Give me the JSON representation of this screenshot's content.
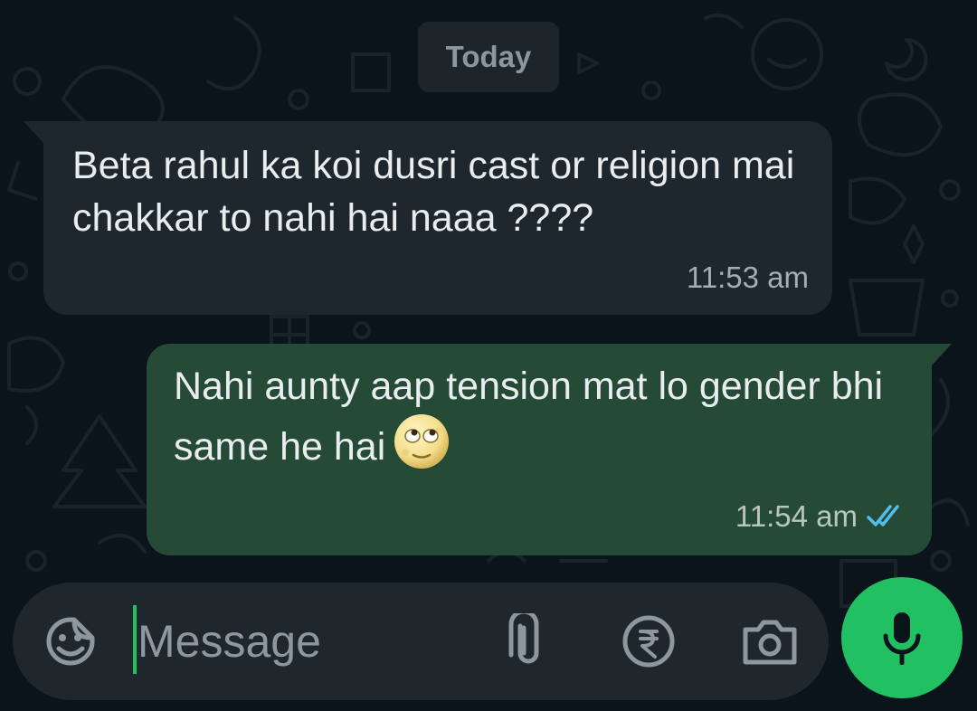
{
  "chat": {
    "date_label": "Today",
    "messages": [
      {
        "direction": "incoming",
        "text": "Beta rahul ka koi dusri cast or religion mai chakkar to nahi hai naaa ????",
        "time": "11:53 am"
      },
      {
        "direction": "outgoing",
        "text": "Nahi aunty aap tension mat lo gender bhi same he hai",
        "emoji": "face-with-rolling-eyes-moon-emoji",
        "time": "11:54 am",
        "status": "read-double-check-icon"
      }
    ]
  },
  "composer": {
    "placeholder": "Message",
    "value": "",
    "icons": [
      "sticker-emoji-icon",
      "paperclip-icon",
      "rupee-payment-icon",
      "camera-icon",
      "microphone-icon"
    ]
  },
  "colors": {
    "background": "#0b141a",
    "incoming_bubble": "#1e272d",
    "outgoing_bubble": "#254b37",
    "accent_green": "#21c063",
    "read_ticks": "#53bdeb"
  }
}
